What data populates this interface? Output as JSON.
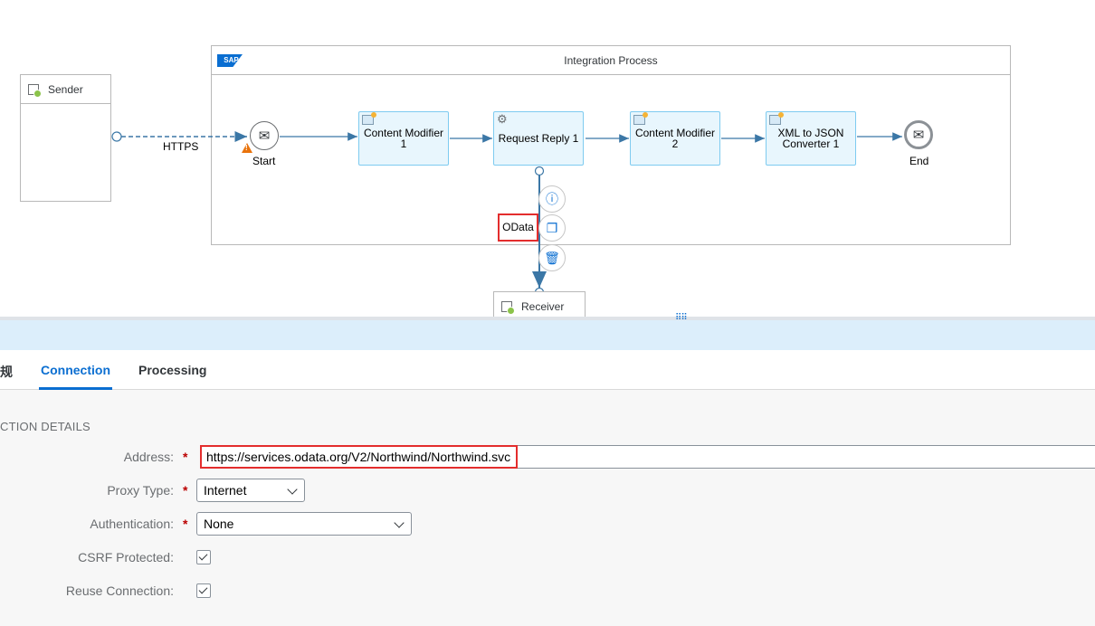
{
  "canvas": {
    "integration_process_title": "Integration Process",
    "sap_logo_text": "SAP",
    "sender_label": "Sender",
    "receiver_label": "Receiver",
    "https_label": "HTTPS",
    "odata_label": "OData",
    "start_label": "Start",
    "end_label": "End",
    "steps": {
      "content_modifier_1": "Content Modifier 1",
      "request_reply_1": "Request Reply 1",
      "content_modifier_2": "Content Modifier 2",
      "xml_to_json": "XML to JSON Converter 1"
    }
  },
  "tabs": {
    "general_partial": "规",
    "connection": "Connection",
    "processing": "Processing"
  },
  "form": {
    "section_title": "CTION DETAILS",
    "address": {
      "label": "Address:",
      "value": "https://services.odata.org/V2/Northwind/Northwind.svc",
      "required": "*"
    },
    "proxy_type": {
      "label": "Proxy Type:",
      "value": "Internet",
      "required": "*"
    },
    "authentication": {
      "label": "Authentication:",
      "value": "None",
      "required": "*"
    },
    "csrf_protected": {
      "label": "CSRF Protected:"
    },
    "reuse_connection": {
      "label": "Reuse Connection:"
    }
  },
  "colors": {
    "accent": "#0a6ed1",
    "highlight": "#e32d2d",
    "step_fill": "#e8f6fd",
    "warning": "#e9730c"
  }
}
